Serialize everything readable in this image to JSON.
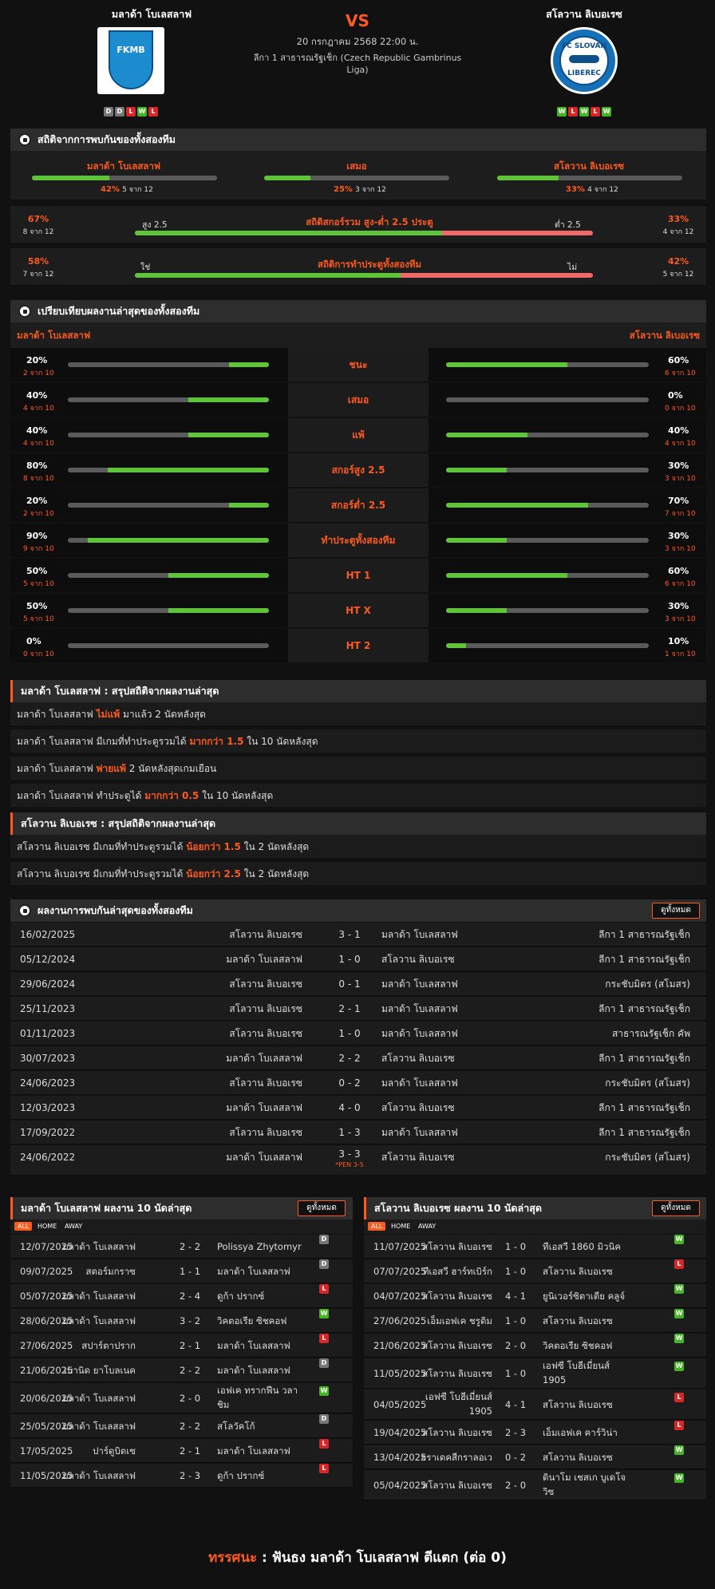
{
  "match": {
    "home": "มลาด้า โบเลสลาฟ",
    "away": "สโลวาน ลิเบอเรซ",
    "vs": "VS",
    "datetime": "20 กรกฎาคม 2568 22:00 น.",
    "league_line1": "ลีกา 1 สาธารณรัฐเช็ก (Czech Republic Gambrinus",
    "league_line2": "Liga)",
    "home_form": [
      "D",
      "D",
      "L",
      "W",
      "L"
    ],
    "away_form": [
      "W",
      "L",
      "W",
      "L",
      "W"
    ],
    "home_logo_text": "FKMB",
    "away_logo_text1": "FC SLOVAN",
    "away_logo_text2": "LIBEREC"
  },
  "h2h_stats": {
    "title": "สถิติจากการพบกันของทั้งสองทีม",
    "cols": [
      {
        "label": "มลาด้า โบเลสลาฟ",
        "pct": "42%",
        "of": "5 จาก 12",
        "value": 0.42
      },
      {
        "label": "เสมอ",
        "pct": "25%",
        "of": "3 จาก 12",
        "value": 0.25
      },
      {
        "label": "สโลวาน ลิเบอเรซ",
        "pct": "33%",
        "of": "4 จาก 12",
        "value": 0.33
      }
    ],
    "ou": {
      "left_pct": "67%",
      "left_of": "8 จาก 12",
      "left_lab": "สูง 2.5",
      "title": "สถิติสกอร์รวม สูง-ต่ำ 2.5 ประตู",
      "right_lab": "ต่ำ 2.5",
      "right_pct": "33%",
      "right_of": "4 จาก 12",
      "value": 0.67
    },
    "btts": {
      "left_pct": "58%",
      "left_of": "7 จาก 12",
      "left_lab": "ใช่",
      "title": "สถิติการทำประตูทั้งสองทีม",
      "right_lab": "ไม่",
      "right_pct": "42%",
      "right_of": "5 จาก 12",
      "value": 0.58
    }
  },
  "compare": {
    "title": "เปรียบเทียบผลงานล่าสุดของทั้งสองทีม",
    "home": "มลาด้า โบเลสลาฟ",
    "away": "สโลวาน ลิเบอเรซ",
    "rows": [
      {
        "label": "ชนะ",
        "lp": "20%",
        "lo": "2 จาก 10",
        "lv": 0.2,
        "rp": "60%",
        "ro": "6 จาก 10",
        "rv": 0.6
      },
      {
        "label": "เสมอ",
        "lp": "40%",
        "lo": "4 จาก 10",
        "lv": 0.4,
        "rp": "0%",
        "ro": "0 จาก 10",
        "rv": 0
      },
      {
        "label": "แพ้",
        "lp": "40%",
        "lo": "4 จาก 10",
        "lv": 0.4,
        "rp": "40%",
        "ro": "4 จาก 10",
        "rv": 0.4
      },
      {
        "label": "สกอร์สูง 2.5",
        "lp": "80%",
        "lo": "8 จาก 10",
        "lv": 0.8,
        "rp": "30%",
        "ro": "3 จาก 10",
        "rv": 0.3
      },
      {
        "label": "สกอร์ต่ำ 2.5",
        "lp": "20%",
        "lo": "2 จาก 10",
        "lv": 0.2,
        "rp": "70%",
        "ro": "7 จาก 10",
        "rv": 0.7
      },
      {
        "label": "ทำประตูทั้งสองทีม",
        "lp": "90%",
        "lo": "9 จาก 10",
        "lv": 0.9,
        "rp": "30%",
        "ro": "3 จาก 10",
        "rv": 0.3
      },
      {
        "label": "HT 1",
        "lp": "50%",
        "lo": "5 จาก 10",
        "lv": 0.5,
        "rp": "60%",
        "ro": "6 จาก 10",
        "rv": 0.6
      },
      {
        "label": "HT X",
        "lp": "50%",
        "lo": "5 จาก 10",
        "lv": 0.5,
        "rp": "30%",
        "ro": "3 จาก 10",
        "rv": 0.3
      },
      {
        "label": "HT 2",
        "lp": "0%",
        "lo": "0 จาก 10",
        "lv": 0,
        "rp": "10%",
        "ro": "1 จาก 10",
        "rv": 0.1
      }
    ]
  },
  "home_summary": {
    "title": "มลาด้า โบเลสลาฟ : สรุปสถิติจากผลงานล่าสุด",
    "lines": [
      [
        "มลาด้า โบเลสลาฟ ",
        "ไม่แพ้",
        " มาแล้ว 2 นัดหลังสุด"
      ],
      [
        "มลาด้า โบเลสลาฟ มีเกมที่ทำประตูรวมได้ ",
        "มากกว่า 1.5",
        " ใน 10 นัดหลังสุด"
      ],
      [
        "มลาด้า โบเลสลาฟ ",
        "พ่ายแพ้",
        " 2 นัดหลังสุดเกมเยือน"
      ],
      [
        "มลาด้า โบเลสลาฟ ทำประตูได้ ",
        "มากกว่า 0.5",
        " ใน 10 นัดหลังสุด"
      ]
    ]
  },
  "away_summary": {
    "title": "สโลวาน ลิเบอเรซ : สรุปสถิติจากผลงานล่าสุด",
    "lines": [
      [
        "สโลวาน ลิเบอเรซ มีเกมที่ทำประตูรวมได้ ",
        "น้อยกว่า 1.5",
        " ใน 2 นัดหลังสุด"
      ],
      [
        "สโลวาน ลิเบอเรซ มีเกมที่ทำประตูรวมได้ ",
        "น้อยกว่า 2.5",
        " ใน 2 นัดหลังสุด"
      ]
    ]
  },
  "h2h_results": {
    "title": "ผลงานการพบกันล่าสุดของทั้งสองทีม",
    "view_all": "ดูทั้งหมด",
    "rows": [
      [
        "16/02/2025",
        "สโลวาน ลิเบอเรซ",
        "3 - 1",
        "มลาด้า โบเลสลาฟ",
        "ลีกา 1 สาธารณรัฐเช็ก",
        ""
      ],
      [
        "05/12/2024",
        "มลาด้า โบเลสลาฟ",
        "1 - 0",
        "สโลวาน ลิเบอเรซ",
        "ลีกา 1 สาธารณรัฐเช็ก",
        ""
      ],
      [
        "29/06/2024",
        "สโลวาน ลิเบอเรซ",
        "0 - 1",
        "มลาด้า โบเลสลาฟ",
        "กระชับมิตร (สโมสร)",
        ""
      ],
      [
        "25/11/2023",
        "สโลวาน ลิเบอเรซ",
        "2 - 1",
        "มลาด้า โบเลสลาฟ",
        "ลีกา 1 สาธารณรัฐเช็ก",
        ""
      ],
      [
        "01/11/2023",
        "สโลวาน ลิเบอเรซ",
        "1 - 0",
        "มลาด้า โบเลสลาฟ",
        "สาธารณรัฐเช็ก คัพ",
        ""
      ],
      [
        "30/07/2023",
        "มลาด้า โบเลสลาฟ",
        "2 - 2",
        "สโลวาน ลิเบอเรซ",
        "ลีกา 1 สาธารณรัฐเช็ก",
        ""
      ],
      [
        "24/06/2023",
        "สโลวาน ลิเบอเรซ",
        "0 - 2",
        "มลาด้า โบเลสลาฟ",
        "กระชับมิตร (สโมสร)",
        ""
      ],
      [
        "12/03/2023",
        "มลาด้า โบเลสลาฟ",
        "4 - 0",
        "สโลวาน ลิเบอเรซ",
        "ลีกา 1 สาธารณรัฐเช็ก",
        ""
      ],
      [
        "17/09/2022",
        "สโลวาน ลิเบอเรซ",
        "1 - 3",
        "มลาด้า โบเลสลาฟ",
        "ลีกา 1 สาธารณรัฐเช็ก",
        ""
      ],
      [
        "24/06/2022",
        "มลาด้า โบเลสลาฟ",
        "3 - 3",
        "สโลวาน ลิเบอเรซ",
        "กระชับมิตร (สโมสร)",
        "*PEN 3-5"
      ]
    ]
  },
  "home_last": {
    "title": "มลาด้า โบเลสลาฟ ผลงาน 10 นัดล่าสุด",
    "view_all": "ดูทั้งหมด",
    "filters": [
      "ALL",
      "HOME",
      "AWAY"
    ],
    "rows": [
      [
        "12/07/2025",
        "มลาด้า โบเลสลาฟ",
        "2 - 2",
        "Polissya Zhytomyr",
        "",
        "D"
      ],
      [
        "09/07/2025",
        "สตอร์มกราซ",
        "1 - 1",
        "มลาด้า โบเลสลาฟ",
        "",
        "D"
      ],
      [
        "05/07/2025",
        "มลาด้า โบเลสลาฟ",
        "2 - 4",
        "ดูก้า ปรากซ์",
        "",
        "L"
      ],
      [
        "28/06/2025",
        "มลาด้า โบเลสลาฟ",
        "3 - 2",
        "วิคตอเรีย ซิชคอฟ",
        "",
        "W"
      ],
      [
        "27/06/2025",
        "สปาร์ตาปราก",
        "2 - 1",
        "มลาด้า โบเลสลาฟ",
        "",
        "L"
      ],
      [
        "21/06/2025",
        "เบานิด ยาโบลเนค",
        "2 - 2",
        "มลาด้า โบเลสลาฟ",
        "",
        "D"
      ],
      [
        "20/06/2025",
        "มลาด้า โบเลสลาฟ",
        "2 - 0",
        "เอฟเค ทรากฟีน วลา",
        "ชิม",
        "W"
      ],
      [
        "25/05/2025",
        "มลาด้า โบเลสลาฟ",
        "2 - 2",
        "สโลวัคโก้",
        "",
        "D"
      ],
      [
        "17/05/2025",
        "ปาร์ดูบิตเซ",
        "2 - 1",
        "มลาด้า โบเลสลาฟ",
        "",
        "L"
      ],
      [
        "11/05/2025",
        "มลาด้า โบเลสลาฟ",
        "2 - 3",
        "ดูก้า ปรากซ์",
        "",
        "L"
      ]
    ]
  },
  "away_last": {
    "title": "สโลวาน ลิเบอเรซ ผลงาน 10 นัดล่าสุด",
    "view_all": "ดูทั้งหมด",
    "filters": [
      "ALL",
      "HOME",
      "AWAY"
    ],
    "rows": [
      [
        "11/07/2025",
        "สโลวาน ลิเบอเรซ",
        "",
        "1 - 0",
        "ทีเอสวี 1860 มิวนิค",
        "",
        "W"
      ],
      [
        "07/07/2025",
        "ทีเอสวี ฮาร์ทเบิร์ก",
        "",
        "1 - 0",
        "สโลวาน ลิเบอเรซ",
        "",
        "L"
      ],
      [
        "04/07/2025",
        "สโลวาน ลิเบอเรซ",
        "",
        "4 - 1",
        "ยูนิเวอร์ซิตาเตีย คลูจ์",
        "",
        "W"
      ],
      [
        "27/06/2025",
        "เอ็มเอฟเค ชรูดิม",
        "",
        "1 - 0",
        "สโลวาน ลิเบอเรซ",
        "",
        "W"
      ],
      [
        "21/06/2025",
        "สโลวาน ลิเบอเรซ",
        "",
        "2 - 0",
        "วิคตอเรีย ซิชคอฟ",
        "",
        "W"
      ],
      [
        "11/05/2025",
        "สโลวาน ลิเบอเรซ",
        "",
        "1 - 0",
        "เอฟซี โบฮีเมี่ยนส์",
        "1905",
        "W"
      ],
      [
        "04/05/2025",
        "เอฟซี โบฮีเมี่ยนส์",
        "1905",
        "4 - 1",
        "สโลวาน ลิเบอเรซ",
        "",
        "L"
      ],
      [
        "19/04/2025",
        "สโลวาน ลิเบอเรซ",
        "",
        "2 - 3",
        "เอ็มเอฟเค คาร์วิน่า",
        "",
        "L"
      ],
      [
        "13/04/2025",
        "ฮราเดคสีกราลอเว",
        "",
        "0 - 2",
        "สโลวาน ลิเบอเรซ",
        "",
        "W"
      ],
      [
        "05/04/2025",
        "สโลวาน ลิเบอเรซ",
        "",
        "2 - 0",
        "ดินาโม เชสเก บูเดโจ",
        "วิซ",
        "W"
      ]
    ]
  },
  "verdict": {
    "label": "ทรรศนะ",
    "colon": " : ",
    "text": "ฟันธง มลาด้า โบเลสลาฟ ตีแตก (ต่อ 0)"
  }
}
